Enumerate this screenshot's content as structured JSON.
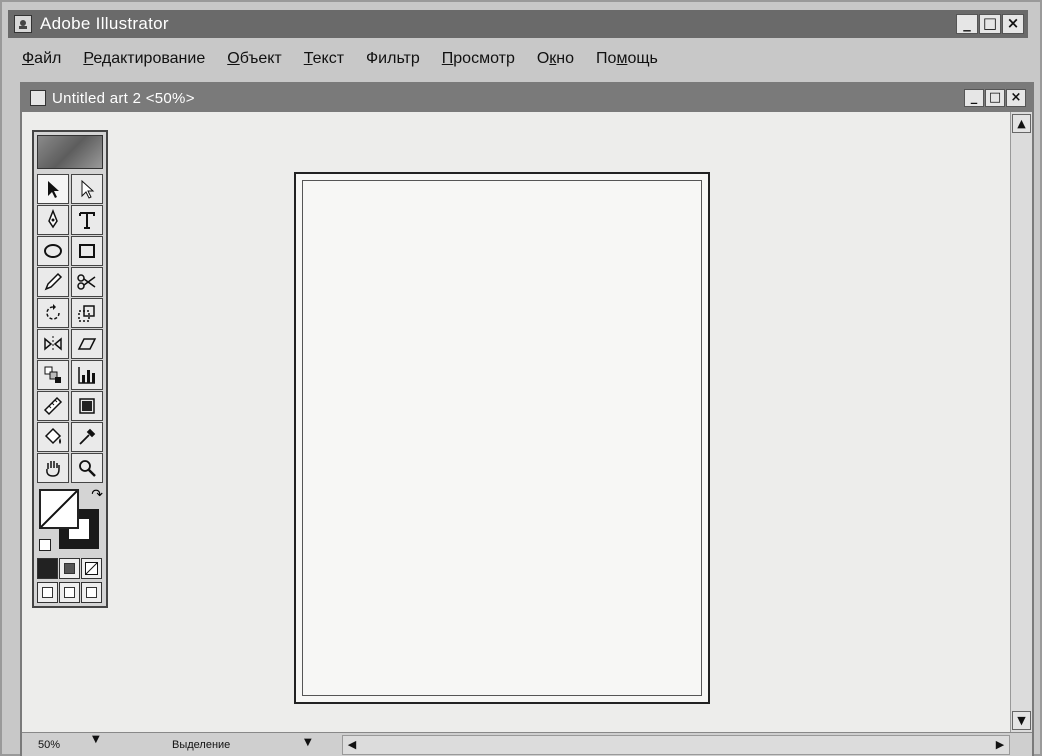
{
  "app": {
    "title": "Adobe Illustrator",
    "window_buttons": [
      "_",
      "□",
      "×"
    ]
  },
  "menu": [
    {
      "underline": "Ф",
      "rest": "айл"
    },
    {
      "underline": "Р",
      "rest": "едактирование"
    },
    {
      "underline": "О",
      "rest": "бъект"
    },
    {
      "underline": "Т",
      "rest": "екст"
    },
    {
      "underline": "",
      "rest": "Фильтр"
    },
    {
      "underline": "П",
      "rest": "росмотр"
    },
    {
      "pre": "О",
      "underline": "к",
      "rest": "но"
    },
    {
      "pre": "По",
      "underline": "м",
      "rest": "ощь"
    }
  ],
  "document": {
    "title": "Untitled art 2 <50%>",
    "window_buttons": [
      "_",
      "□",
      "×"
    ]
  },
  "statusbar": {
    "zoom": "50%",
    "mode": "Выделение"
  },
  "toolbox": {
    "tools": [
      "selection-tool",
      "direct-selection-tool",
      "pen-tool",
      "type-tool",
      "ellipse-tool",
      "rectangle-tool",
      "pencil-tool",
      "scissors-tool",
      "rotate-tool",
      "scale-tool",
      "reflect-tool",
      "shear-tool",
      "blend-tool",
      "graph-tool",
      "measure-tool",
      "gradient-tool",
      "paint-bucket-tool",
      "eyedropper-tool",
      "hand-tool",
      "zoom-tool"
    ]
  },
  "colors": {
    "titlebar": "#6a6a6a",
    "doc_titlebar": "#7a7a7a",
    "artboard_border": "#222222",
    "stroke": "#1a1a1a",
    "fill": "#ffffff"
  }
}
